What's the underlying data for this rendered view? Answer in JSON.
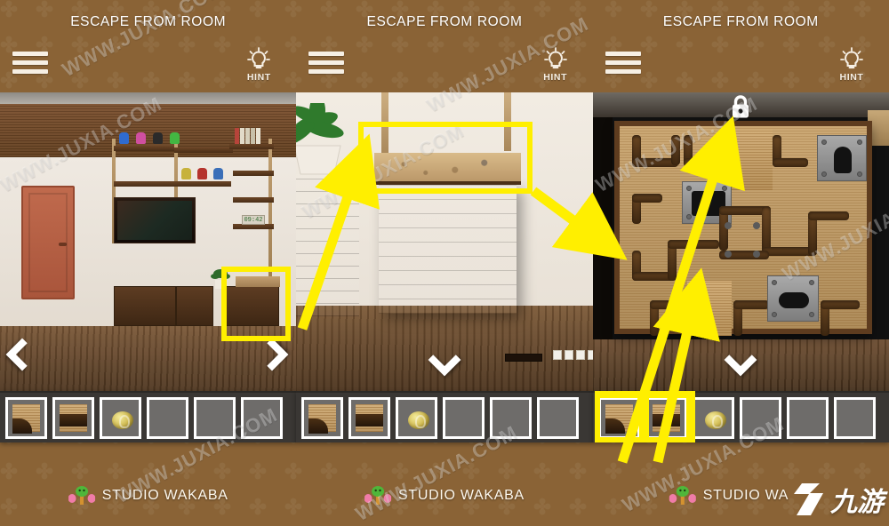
{
  "app": {
    "title": "ESCAPE FROM ROOM",
    "studio_name": "STUDIO WAKABA",
    "studio_name_truncated": "STUDIO WA",
    "hint_label": "HINT",
    "bg_color": "#8a6336",
    "highlight_color": "#ffef00",
    "inventory_bar_color": "#3a3734",
    "slot_color": "#6e6c6a"
  },
  "watermark": {
    "text": "WWW.JUXIA.COM",
    "logo_text": "九游"
  },
  "panels": [
    {
      "id": "panel-room-overview",
      "title": "ESCAPE FROM ROOM",
      "hint_label": "HINT",
      "menu_icon": "hamburger-icon",
      "hint_icon": "lightbulb-icon",
      "scene_description": "living room with door, tv shelf unit and cabinets",
      "clock_value": "09:42",
      "nav": [
        {
          "name": "nav-left",
          "icon": "chevron-left-icon"
        },
        {
          "name": "nav-right",
          "icon": "chevron-right-icon"
        }
      ],
      "highlight": {
        "label": "cabinet-highlight"
      },
      "inventory": [
        {
          "name": "wood-pipe-corner",
          "icon": "pipe-corner-item",
          "highlighted": false
        },
        {
          "name": "wood-pipe-straight",
          "icon": "pipe-straight-item",
          "highlighted": false
        },
        {
          "name": "gold-coin",
          "icon": "coin-item",
          "highlighted": false
        },
        {
          "name": "empty",
          "icon": "",
          "highlighted": false
        },
        {
          "name": "empty",
          "icon": "",
          "highlighted": false
        },
        {
          "name": "empty",
          "icon": "",
          "highlighted": false
        }
      ],
      "footer_text": "STUDIO WAKABA"
    },
    {
      "id": "panel-cabinet-closeup",
      "title": "ESCAPE FROM ROOM",
      "hint_label": "HINT",
      "menu_icon": "hamburger-icon",
      "hint_icon": "lightbulb-icon",
      "scene_description": "close up of wooden cabinet with cork puzzle board on top",
      "nav": [
        {
          "name": "nav-down",
          "icon": "chevron-down-icon"
        }
      ],
      "highlight": {
        "label": "cork-board-highlight"
      },
      "inventory": [
        {
          "name": "wood-pipe-corner",
          "icon": "pipe-corner-item",
          "highlighted": false
        },
        {
          "name": "wood-pipe-straight",
          "icon": "pipe-straight-item",
          "highlighted": false
        },
        {
          "name": "gold-coin",
          "icon": "coin-item",
          "highlighted": false
        },
        {
          "name": "empty",
          "icon": "",
          "highlighted": false
        },
        {
          "name": "empty",
          "icon": "",
          "highlighted": false
        },
        {
          "name": "empty",
          "icon": "",
          "highlighted": false
        }
      ],
      "footer_text": "STUDIO WAKABA"
    },
    {
      "id": "panel-pipe-puzzle",
      "title": "ESCAPE FROM ROOM",
      "hint_label": "HINT",
      "menu_icon": "hamburger-icon",
      "hint_icon": "lightbulb-icon",
      "scene_description": "sliding wooden pipe maze puzzle board, locked",
      "lock_icon": "lock-icon",
      "nav": [
        {
          "name": "nav-down",
          "icon": "chevron-down-icon"
        }
      ],
      "inventory": [
        {
          "name": "wood-pipe-corner",
          "icon": "pipe-corner-item",
          "highlighted": true
        },
        {
          "name": "wood-pipe-straight",
          "icon": "pipe-straight-item",
          "highlighted": true
        },
        {
          "name": "gold-coin",
          "icon": "coin-item",
          "highlighted": false
        },
        {
          "name": "empty",
          "icon": "",
          "highlighted": false
        },
        {
          "name": "empty",
          "icon": "",
          "highlighted": false
        },
        {
          "name": "empty",
          "icon": "",
          "highlighted": false
        }
      ],
      "footer_text": "STUDIO WA"
    }
  ],
  "annotations": {
    "arrows": [
      {
        "name": "arrow-cabinet-to-corkboard",
        "from": "panel1-cabinet",
        "to": "panel2-corkboard"
      },
      {
        "name": "arrow-corkboard-to-puzzle",
        "from": "panel2-corkboard",
        "to": "panel3-board"
      },
      {
        "name": "arrow-item1-to-slot",
        "from": "panel3-inventory-1",
        "to": "panel3-board-lower"
      },
      {
        "name": "arrow-item2-to-slot",
        "from": "panel3-inventory-2",
        "to": "panel3-board-upper"
      }
    ]
  }
}
